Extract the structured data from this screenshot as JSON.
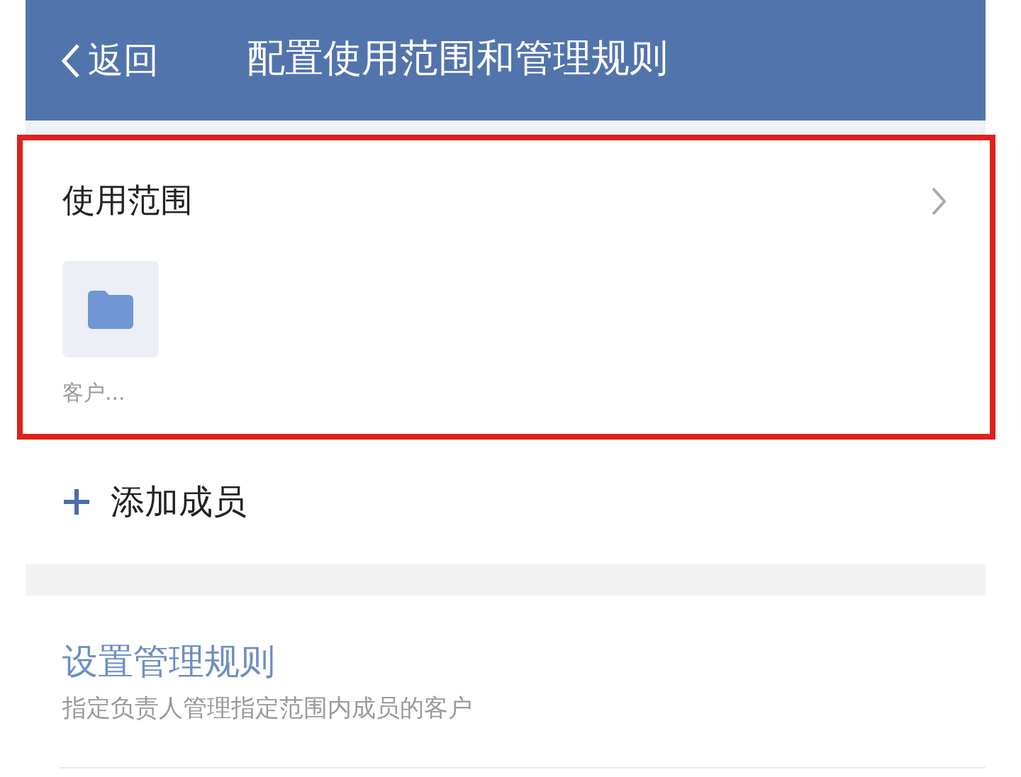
{
  "header": {
    "back": "返回",
    "title": "配置使用范围和管理规则"
  },
  "scope": {
    "title": "使用范围",
    "highlighted": true,
    "items": [
      {
        "label": "客户..."
      }
    ]
  },
  "add_member": {
    "label": "添加成员"
  },
  "rules": {
    "title": "设置管理规则",
    "description": "指定负责人管理指定范围内成员的客户"
  }
}
